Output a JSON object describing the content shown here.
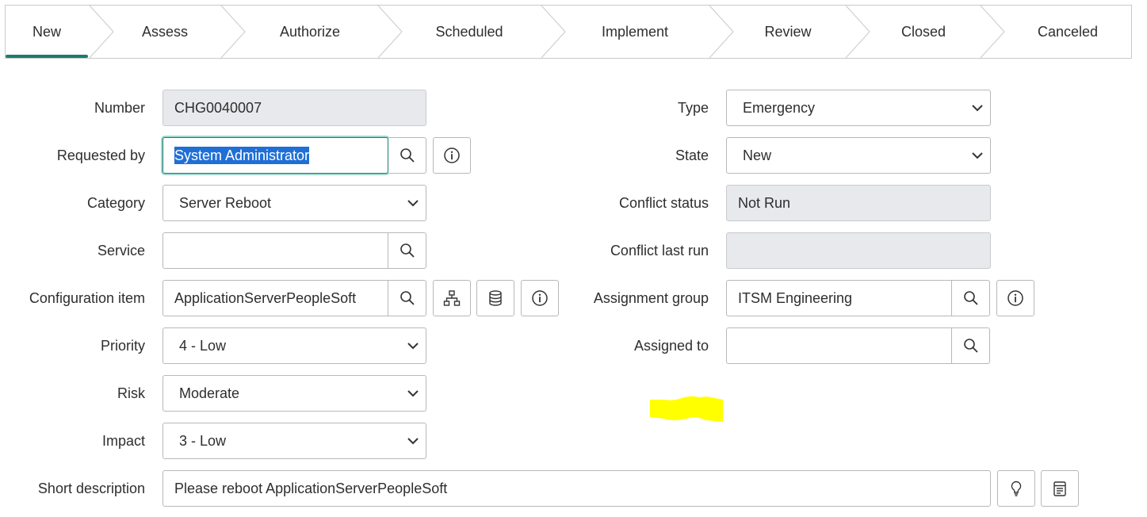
{
  "stages": [
    "New",
    "Assess",
    "Authorize",
    "Scheduled",
    "Implement",
    "Review",
    "Closed",
    "Canceled"
  ],
  "active_stage": "New",
  "form": {
    "number": {
      "label": "Number",
      "value": "CHG0040007"
    },
    "requested_by": {
      "label": "Requested by",
      "value": "System Administrator"
    },
    "category": {
      "label": "Category",
      "value": "Server Reboot"
    },
    "service": {
      "label": "Service",
      "value": ""
    },
    "configuration_item": {
      "label": "Configuration item",
      "value": "ApplicationServerPeopleSoft"
    },
    "priority": {
      "label": "Priority",
      "value": "4 - Low"
    },
    "risk": {
      "label": "Risk",
      "value": "Moderate"
    },
    "impact": {
      "label": "Impact",
      "value": "3 - Low"
    },
    "short_description": {
      "label": "Short description",
      "value": "Please reboot ApplicationServerPeopleSoft"
    },
    "type": {
      "label": "Type",
      "value": "Emergency"
    },
    "state": {
      "label": "State",
      "value": "New"
    },
    "conflict_status": {
      "label": "Conflict status",
      "value": "Not Run"
    },
    "conflict_last_run": {
      "label": "Conflict last run",
      "value": ""
    },
    "assignment_group": {
      "label": "Assignment group",
      "value": "ITSM Engineering"
    },
    "assigned_to": {
      "label": "Assigned to",
      "value": ""
    }
  },
  "icons": {
    "lookup": "search-icon",
    "info": "info-icon",
    "dependency": "dependency-map-icon",
    "cmdb": "database-icon",
    "suggest": "lightbulb-icon",
    "template": "template-icon",
    "dropdown": "chevron-down-icon"
  },
  "colors": {
    "active_stage_underline": "#1e7a6f",
    "readonly_bg": "#e7e9ec",
    "selection_bg": "#1f6fd6",
    "highlighter": "#ffff00"
  }
}
